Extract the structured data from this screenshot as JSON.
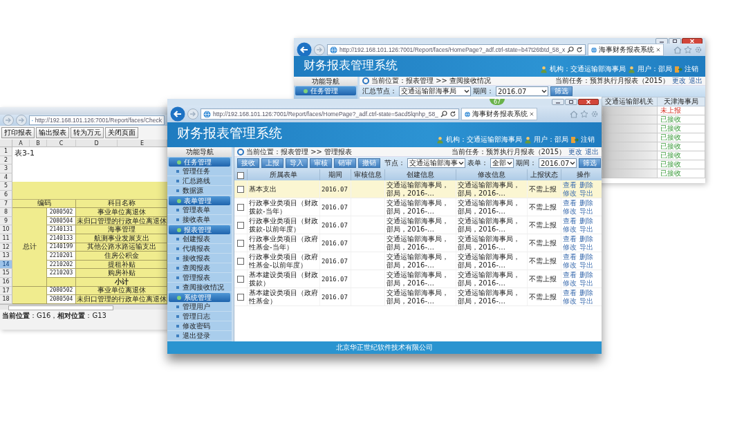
{
  "spreadsheet_window": {
    "url": "http://192.168.101.126:7001/Report/faces/Check",
    "toolbar": [
      "打印报表",
      "输出报表",
      "转为万元",
      "关闭页面"
    ],
    "columns": [
      "A",
      "B",
      "C",
      "D",
      "E"
    ],
    "rows": [
      {
        "number": "1",
        "selected": false
      },
      {
        "number": "2",
        "selected": false
      },
      {
        "number": "3",
        "selected": false
      },
      {
        "number": "4",
        "selected": false
      },
      {
        "number": "5",
        "selected": false
      },
      {
        "number": "6",
        "selected": false
      },
      {
        "number": "7",
        "selected": false
      },
      {
        "number": "8",
        "selected": false
      },
      {
        "number": "9",
        "selected": false
      },
      {
        "number": "10",
        "selected": false
      },
      {
        "number": "11",
        "selected": false
      },
      {
        "number": "12",
        "selected": false
      },
      {
        "number": "13",
        "selected": false
      },
      {
        "number": "14",
        "selected": true
      },
      {
        "number": "15",
        "selected": false
      },
      {
        "number": "16",
        "selected": false
      },
      {
        "number": "17",
        "selected": false
      },
      {
        "number": "18",
        "selected": false
      }
    ],
    "title": "表3-1",
    "header": {
      "code": "编码",
      "name": "科目名称"
    },
    "groups": [
      {
        "label": "总计",
        "items": [
          {
            "code": "2080502",
            "name": "事业单位离退休"
          },
          {
            "code": "2080504",
            "name": "未归口管理的行政单位离退休"
          },
          {
            "code": "2140131",
            "name": "海事管理"
          },
          {
            "code": "2140133",
            "name": "航测事业发展支出"
          },
          {
            "code": "2140199",
            "name": "其他公路水路运输支出"
          },
          {
            "code": "2210201",
            "name": "住房公积金"
          },
          {
            "code": "2210202",
            "name": "提租补贴"
          },
          {
            "code": "2210203",
            "name": "购房补贴"
          }
        ],
        "subtotal": "小计"
      },
      {
        "items": [
          {
            "code": "2080502",
            "name": "事业单位离退休"
          },
          {
            "code": "2080504",
            "name": "未归口管理的行政单位离退休"
          }
        ]
      }
    ],
    "status": "**当前位置**：G16，**相对位置**：G13"
  },
  "back_window": {
    "url": "http://192.168.101.126:7001/Report/faces/HomePage?_adf.ctrl-state=b47t26tbtd_58_x",
    "tab": "海事财务报表系统",
    "app_title": "财务报表管理系统",
    "org": "机构：交通运输部海事局",
    "user": "用户：邵局",
    "logout": "注销",
    "nav_title": "功能导航",
    "nav_section": "任务管理",
    "breadcrumb": "当前位置：报表管理 >> 查阅接收情况",
    "current_task": "当前任务：预算执行月报表（2015）",
    "task_links": [
      "更改",
      "退出"
    ],
    "filters": [
      {
        "label": "汇总节点：",
        "value": "交通运输部海事局"
      },
      {
        "label": "期间：",
        "value": "2016.07"
      }
    ],
    "filter_button": "筛选",
    "table": {
      "columns": [
        "交通运输部机关",
        "天津海事局"
      ],
      "rows": [
        {
          "status": "未上报",
          "kind": "pending"
        },
        {
          "status": "已接收",
          "kind": "received"
        },
        {
          "status": "已接收",
          "kind": "received"
        },
        {
          "status": "已接收",
          "kind": "received"
        },
        {
          "status": "已接收",
          "kind": "received"
        },
        {
          "status": "已接收",
          "kind": "received"
        },
        {
          "status": "已接收",
          "kind": "received"
        },
        {
          "status": "已接收",
          "kind": "received"
        }
      ]
    }
  },
  "front_window": {
    "url": "http://192.168.101.126:7001/Report/faces/HomePage?_adf.ctrl-state=5acd5lqnhp_58_",
    "tab": "海事财务报表系统",
    "badge": "67",
    "app_title": "财务报表管理系统",
    "org": "机构：交通运输部海事局",
    "user": "用户：邵局",
    "logout": "注销",
    "nav": {
      "title": "功能导航",
      "sections": [
        {
          "label": "任务管理",
          "items": [
            "管理任务",
            "汇总路线",
            "数据源"
          ]
        },
        {
          "label": "表单管理",
          "items": [
            "管理表单",
            "接收表单"
          ]
        },
        {
          "label": "报表管理",
          "items": [
            "创建报表",
            "代填报表",
            "接收报表",
            "查阅报表",
            "管理报表",
            "查阅接收情况"
          ]
        },
        {
          "label": "系统管理",
          "items": [
            "管理用户",
            "管理日志",
            "修改密码",
            "退出登录"
          ]
        }
      ]
    },
    "breadcrumb": "当前位置：报表管理 >> 管理报表",
    "current_task": "当前任务：预算执行月报表（2015）",
    "task_links": [
      "更改",
      "退出"
    ],
    "actions": [
      "接收",
      "上报",
      "导入",
      "审核",
      "销审",
      "撤销"
    ],
    "filters": [
      {
        "label": "节点：",
        "value": "交通运输部海事"
      },
      {
        "label": "表单：",
        "value": "全部"
      },
      {
        "label": "期间：",
        "value": "2016.07"
      }
    ],
    "filter_button": "筛选",
    "table": {
      "select_all_checked": false,
      "columns": [
        "所属表单",
        "期间",
        "审核信息",
        "创建信息",
        "修改信息",
        "上报状态",
        "操作"
      ],
      "rows": [
        {
          "form": "基本支出",
          "period": "2016.07",
          "created": "交通运输部海事局，邵局，2016-…",
          "modified": "交通运输部海事局，邵局，2016-…",
          "status": "不需上报",
          "ops": [
            "查看",
            "删除",
            "修改",
            "导出"
          ],
          "checked": false,
          "selected": true
        },
        {
          "form": "行政事业类项目（财政拨款-当年）",
          "period": "2016.07",
          "created": "交通运输部海事局，邵局，2016-…",
          "modified": "交通运输部海事局，邵局，2016-…",
          "status": "不需上报",
          "ops": [
            "查看",
            "删除",
            "修改",
            "导出"
          ],
          "checked": false,
          "selected": false
        },
        {
          "form": "行政事业类项目（财政拨款-以前年度）",
          "period": "2016.07",
          "created": "交通运输部海事局，邵局，2016-…",
          "modified": "交通运输部海事局，邵局，2016-…",
          "status": "不需上报",
          "ops": [
            "查看",
            "删除",
            "修改",
            "导出"
          ],
          "checked": false,
          "selected": false
        },
        {
          "form": "行政事业类项目（政府性基金-当年）",
          "period": "2016.07",
          "created": "交通运输部海事局，邵局，2016-…",
          "modified": "交通运输部海事局，邵局，2016-…",
          "status": "不需上报",
          "ops": [
            "查看",
            "删除",
            "修改",
            "导出"
          ],
          "checked": false,
          "selected": false
        },
        {
          "form": "行政事业类项目（政府性基金-以前年度）",
          "period": "2016.07",
          "created": "交通运输部海事局，邵局，2016-…",
          "modified": "交通运输部海事局，邵局，2016-…",
          "status": "不需上报",
          "ops": [
            "查看",
            "删除",
            "修改",
            "导出"
          ],
          "checked": false,
          "selected": false
        },
        {
          "form": "基本建设类项目（财政拨款）",
          "period": "2016.07",
          "created": "交通运输部海事局，邵局，2016-…",
          "modified": "交通运输部海事局，邵局，2016-…",
          "status": "不需上报",
          "ops": [
            "查看",
            "删除",
            "修改",
            "导出"
          ],
          "checked": false,
          "selected": false
        },
        {
          "form": "基本建设类项目（政府性基金）",
          "period": "2016.07",
          "created": "交通运输部海事局，邵局，2016-…",
          "modified": "交通运输部海事局，邵局，2016-…",
          "status": "不需上报",
          "ops": [
            "查看",
            "删除",
            "修改",
            "导出"
          ],
          "checked": false,
          "selected": false
        }
      ]
    },
    "footer": "北京华正世纪软件技术有限公司"
  }
}
